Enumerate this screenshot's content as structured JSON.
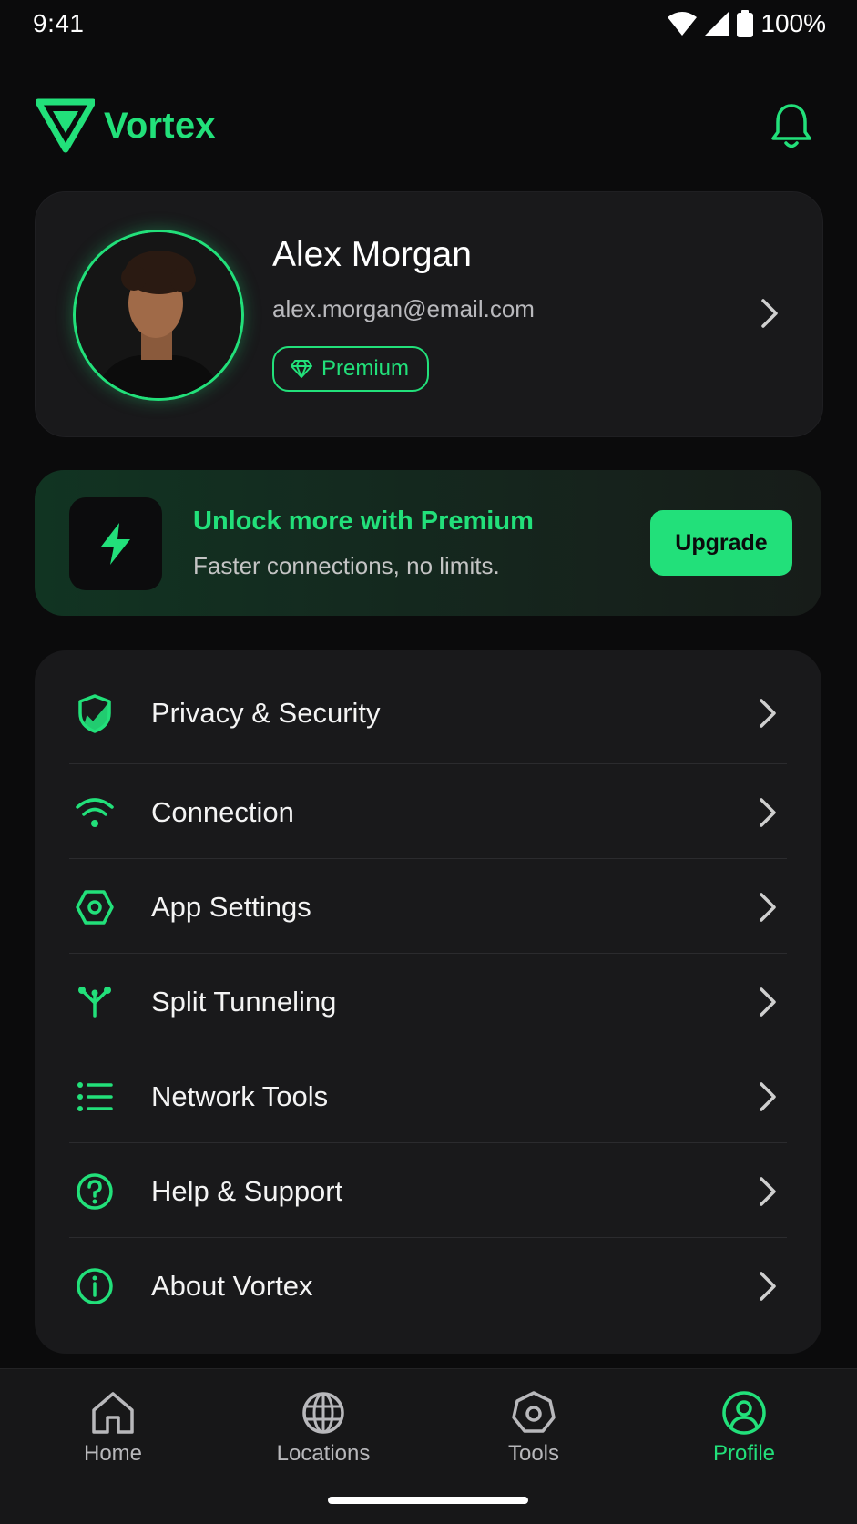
{
  "status_bar": {
    "time": "9:41",
    "battery": "100%"
  },
  "header": {
    "brand_name": "Vortex"
  },
  "profile": {
    "name": "Alex Morgan",
    "email": "alex.morgan@email.com",
    "badge": "Premium"
  },
  "promo": {
    "title": "Unlock more with Premium",
    "subtitle": "Faster connections, no limits.",
    "button": "Upgrade"
  },
  "menu": {
    "items": [
      {
        "label": "Privacy & Security",
        "icon": "shield-check-icon"
      },
      {
        "label": "Connection",
        "icon": "wifi-icon"
      },
      {
        "label": "App Settings",
        "icon": "hexagon-settings-icon"
      },
      {
        "label": "Split Tunneling",
        "icon": "split-icon"
      },
      {
        "label": "Network Tools",
        "icon": "list-icon"
      },
      {
        "label": "Help & Support",
        "icon": "help-circle-icon"
      },
      {
        "label": "About Vortex",
        "icon": "info-icon"
      }
    ]
  },
  "nav": {
    "items": [
      {
        "label": "Home",
        "icon": "home-icon"
      },
      {
        "label": "Locations",
        "icon": "globe-icon"
      },
      {
        "label": "Tools",
        "icon": "tools-icon"
      },
      {
        "label": "Profile",
        "icon": "profile-icon",
        "active": true
      }
    ]
  },
  "colors": {
    "accent": "#22e07a",
    "background": "#0b0b0c",
    "card": "#19191b"
  }
}
